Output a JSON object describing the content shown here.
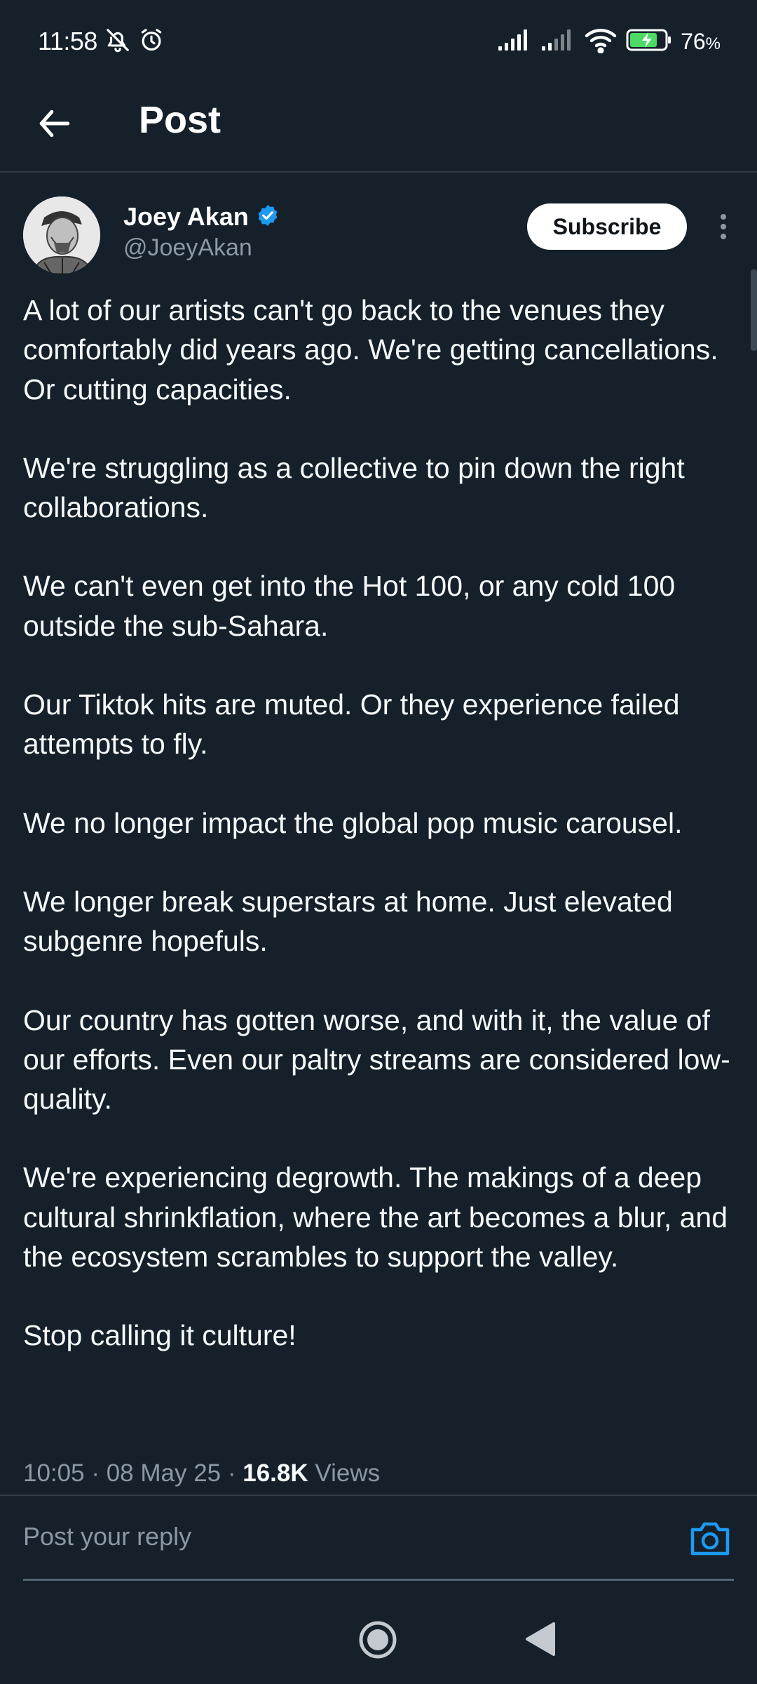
{
  "status_bar": {
    "time": "11:58",
    "battery_percent": "76",
    "battery_unit": "%",
    "icons": [
      "mute-bell-icon",
      "alarm-icon",
      "signal-icon",
      "signal-icon",
      "wifi-icon",
      "battery-charging-icon"
    ]
  },
  "header": {
    "title": "Post",
    "back_icon": "back-arrow-icon"
  },
  "author": {
    "name": "Joey Akan",
    "handle": "@JoeyAkan",
    "verified": true,
    "subscribe_label": "Subscribe"
  },
  "post": {
    "paragraphs": [
      "A lot of our artists can't go back to the venues they comfortably did years ago. We're getting cancellations. Or cutting capacities.",
      "We're struggling as a collective to pin down the right collaborations.",
      "We can't even get into the Hot 100, or any cold 100 outside the sub-Sahara.",
      "Our Tiktok hits are muted. Or they experience failed attempts to fly.",
      "We no longer impact the global pop music carousel.",
      "We longer break superstars at home. Just elevated subgenre hopefuls.",
      "Our country has gotten worse, and with it, the value of our efforts. Even our paltry streams are considered low-quality.",
      "We're experiencing degrowth. The makings of a deep cultural shrinkflation, where the art becomes a blur, and the ecosystem scrambles to support the valley.",
      "Stop calling it culture!"
    ],
    "time": "10:05",
    "separator": " · ",
    "date": "08 May 25",
    "views_count": "16.8K",
    "views_label": " Views"
  },
  "reply": {
    "placeholder": "Post your reply"
  },
  "colors": {
    "background": "#15202b",
    "accent": "#1d9bf0",
    "muted_text": "#8b98a5",
    "divider": "#2f3b47"
  }
}
